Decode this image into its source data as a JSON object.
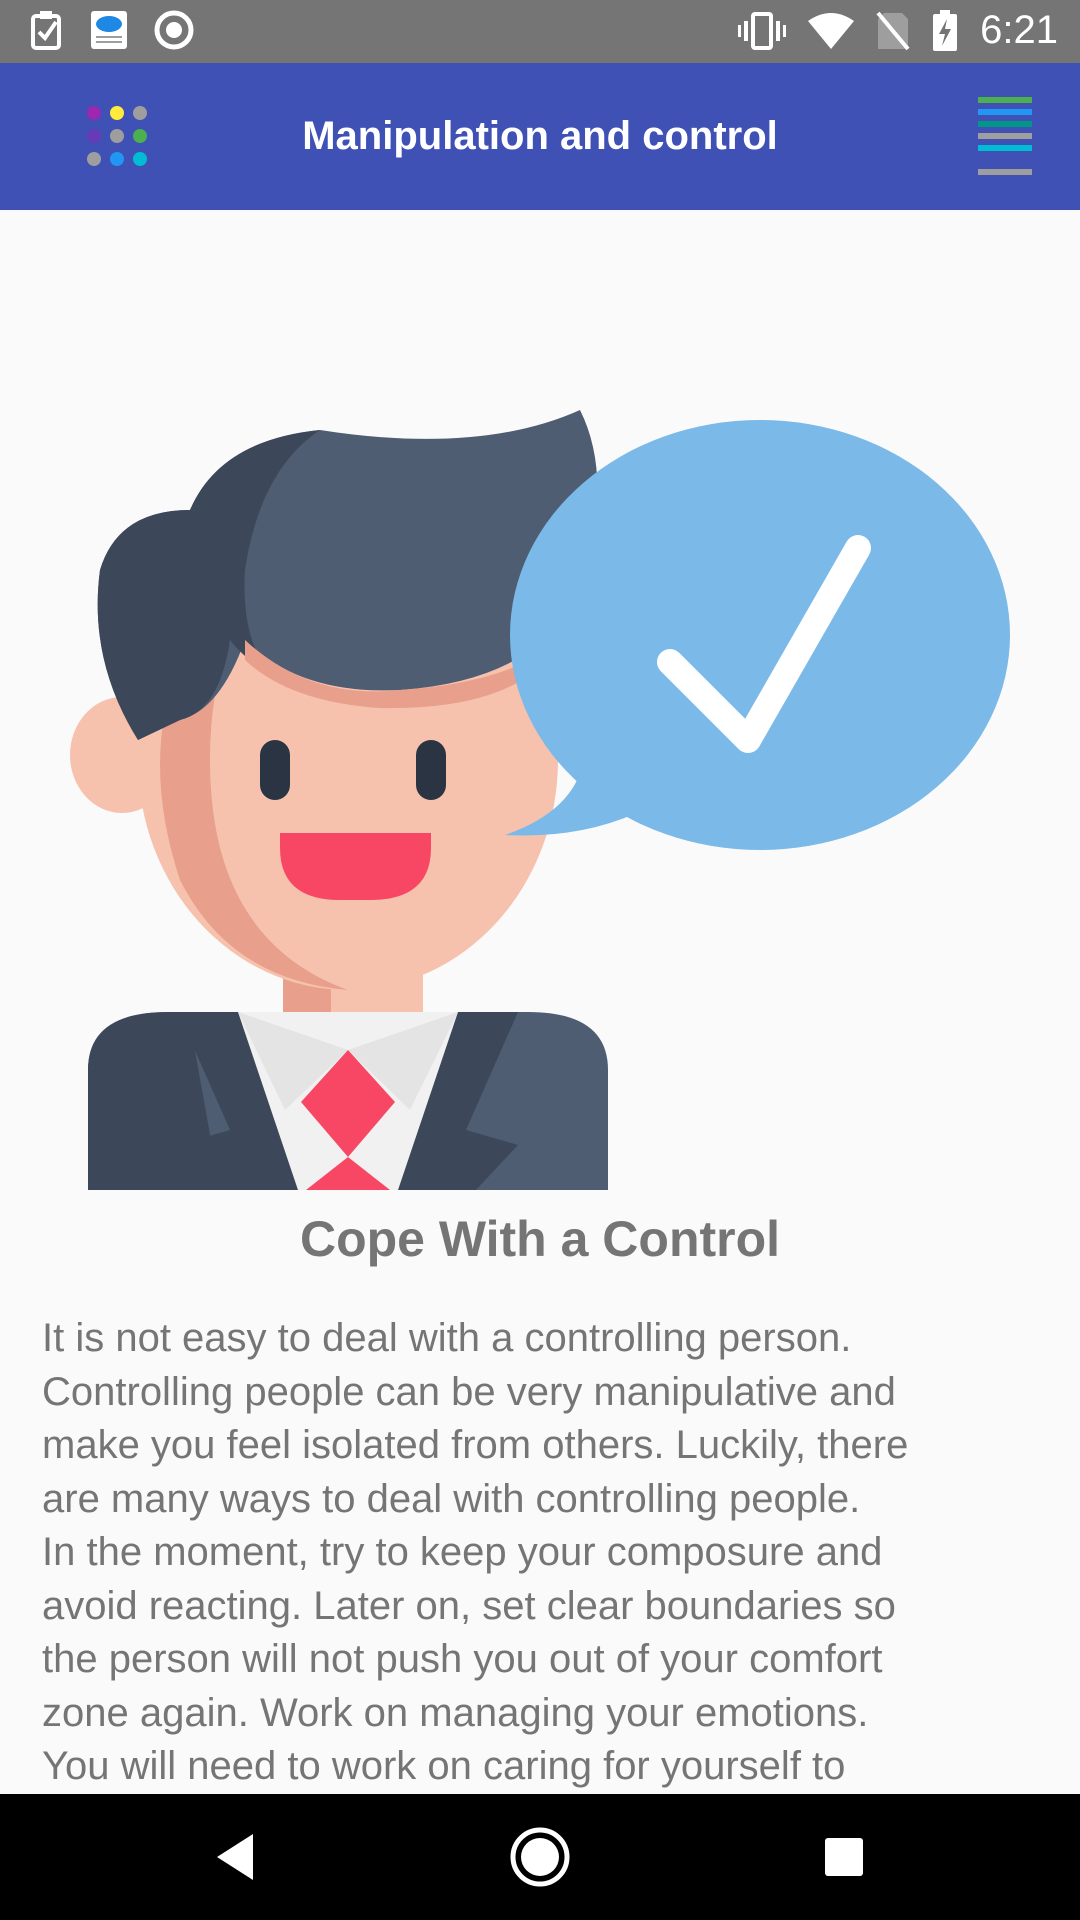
{
  "status_bar": {
    "time": "6:21",
    "left_icons": [
      "task-check-icon",
      "weather-app-icon",
      "record-circle-icon"
    ],
    "right_icons": [
      "vibrate-icon",
      "wifi-icon",
      "no-sim-icon",
      "battery-charging-icon"
    ]
  },
  "app_bar": {
    "title": "Manipulation and control",
    "left_icon": "apps-grid-icon",
    "right_icon": "menu-lines-icon",
    "color": "#3f51b5"
  },
  "article": {
    "illustration": "smiling-businessman-with-checkmark-speech-bubble",
    "title": "Cope With a Control",
    "paragraph_lines": [
      "It is not easy to deal with a controlling person.",
      "Controlling people can be very manipulative and",
      "make you feel isolated from others. Luckily, there",
      "are many ways to deal with controlling people.",
      "In the moment, try to keep your composure and",
      "avoid reacting. Later on, set clear boundaries so",
      "the person will not push you out of your comfort",
      "zone again. Work on managing your emotions.",
      "You will need to work on caring for yourself to"
    ]
  },
  "nav_bar": {
    "back": "back-triangle-icon",
    "home": "home-circle-icon",
    "recents": "recents-square-icon"
  }
}
